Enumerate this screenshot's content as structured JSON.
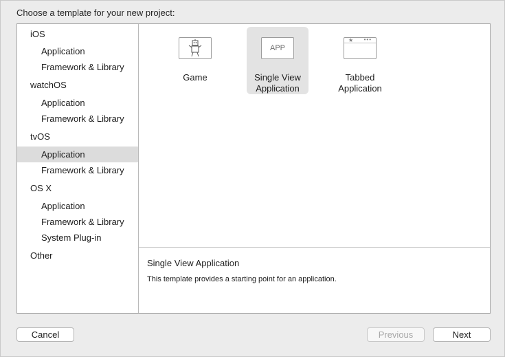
{
  "dialog": {
    "prompt": "Choose a template for your new project:"
  },
  "sidebar": {
    "items": [
      {
        "label": "iOS",
        "kind": "category"
      },
      {
        "label": "Application",
        "kind": "item"
      },
      {
        "label": "Framework & Library",
        "kind": "item"
      },
      {
        "label": "watchOS",
        "kind": "category"
      },
      {
        "label": "Application",
        "kind": "item"
      },
      {
        "label": "Framework & Library",
        "kind": "item"
      },
      {
        "label": "tvOS",
        "kind": "category"
      },
      {
        "label": "Application",
        "kind": "item",
        "selected": true
      },
      {
        "label": "Framework & Library",
        "kind": "item"
      },
      {
        "label": "OS X",
        "kind": "category"
      },
      {
        "label": "Application",
        "kind": "item"
      },
      {
        "label": "Framework & Library",
        "kind": "item"
      },
      {
        "label": "System Plug-in",
        "kind": "item"
      },
      {
        "label": "Other",
        "kind": "category"
      }
    ]
  },
  "templates": [
    {
      "label": "Game",
      "icon": "game-robot-icon",
      "selected": false
    },
    {
      "label": "Single View\nApplication",
      "icon": "app-icon",
      "icon_text": "APP",
      "selected": true
    },
    {
      "label": "Tabbed\nApplication",
      "icon": "tabbed-app-icon",
      "tab_star": "★",
      "tab_dots": "•••",
      "selected": false
    }
  ],
  "description": {
    "title": "Single View Application",
    "text": "This template provides a starting point for an application."
  },
  "buttons": {
    "cancel": "Cancel",
    "previous": "Previous",
    "next": "Next"
  },
  "colors": {
    "selection": "#dcdcdc",
    "window": "#ececec",
    "disabled_text": "#a8a8a8"
  }
}
